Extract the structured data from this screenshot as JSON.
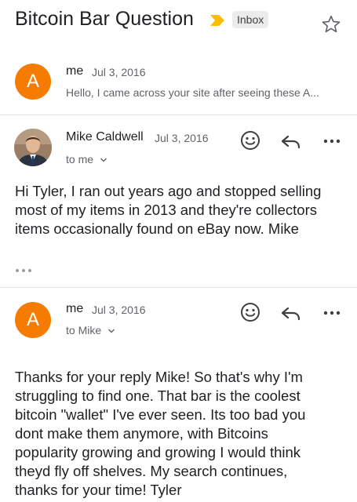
{
  "subject": "Bitcoin Bar Question",
  "label": "Inbox",
  "messages": [
    {
      "avatar_letter": "A",
      "sender": "me",
      "date": "Jul 3, 2016",
      "snippet": "Hello, I came across your site after seeing these A..."
    },
    {
      "sender": "Mike Caldwell",
      "date": "Jul 3, 2016",
      "recipient": "to me",
      "body": "Hi Tyler, I ran out years ago and stopped selling most of my items in 2013 and they're collectors items occasionally found on eBay now. Mike"
    },
    {
      "avatar_letter": "A",
      "sender": "me",
      "date": "Jul 3, 2016",
      "recipient": "to Mike",
      "body": "Thanks for your reply Mike! So that's why I'm struggling to find one. That bar is the coolest bitcoin \"wallet\" I've ever seen. Its too bad you dont make them anymore, with Bitcoins popularity growing and growing I would think theyd fly off shelves. My search continues, thanks for your time! Tyler"
    }
  ],
  "colors": {
    "avatar": "#f57c00",
    "importance": "#fbbc04",
    "badge_bg": "#ececec"
  },
  "icons": [
    "importance-marker-icon",
    "star-icon",
    "emoji-icon",
    "reply-icon",
    "more-icon",
    "chevron-down-icon",
    "collapsed-content-icon"
  ]
}
